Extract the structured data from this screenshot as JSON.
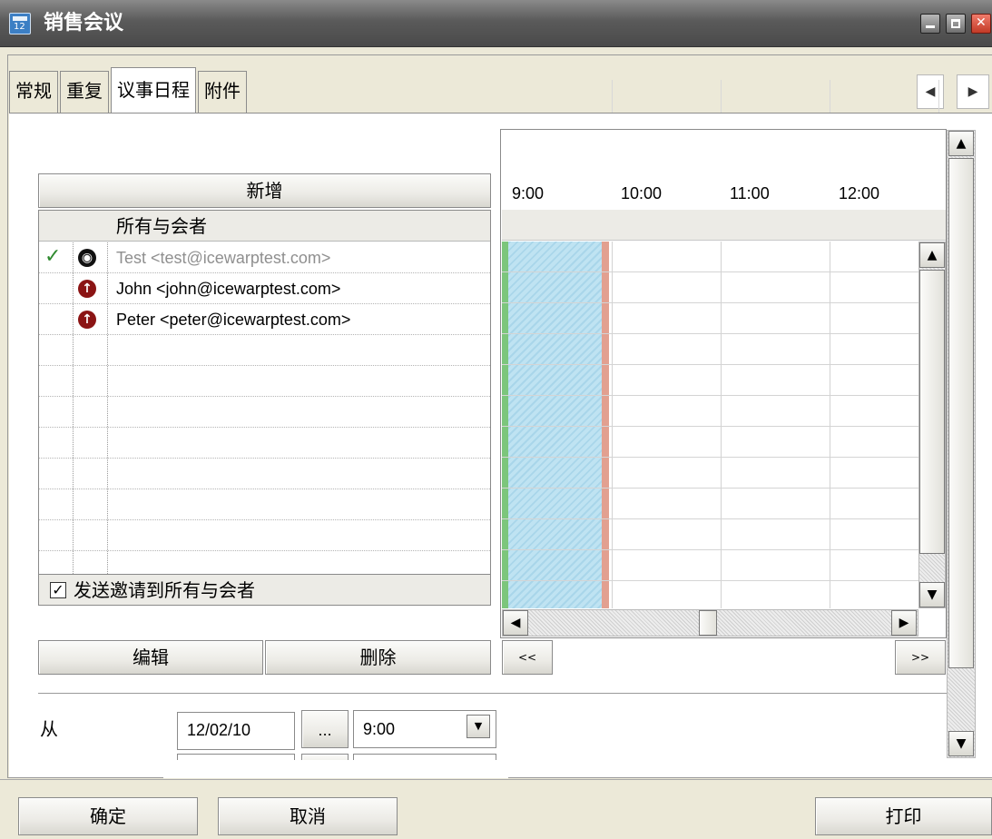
{
  "window": {
    "title": "销售会议",
    "icon_label": "12"
  },
  "tabs": [
    {
      "label": "常规"
    },
    {
      "label": "重复"
    },
    {
      "label": "议事日程",
      "active": true
    },
    {
      "label": "附件"
    }
  ],
  "tab_scroll": {
    "left": "◀",
    "right": "▶"
  },
  "attendees": {
    "add_label": "新增",
    "header": "所有与会者",
    "rows": [
      {
        "email": "Test <test@icewarptest.com>",
        "checked": true,
        "status": "accepted-icon"
      },
      {
        "email": "John <john@icewarptest.com>",
        "checked": false,
        "status": "pending-icon"
      },
      {
        "email": "Peter <peter@icewarptest.com>",
        "checked": false,
        "status": "pending-icon"
      }
    ],
    "send_invite_label": "发送邀请到所有与会者",
    "send_invite_checked": true,
    "edit_label": "编辑",
    "delete_label": "删除"
  },
  "schedule": {
    "hours": [
      "9:00",
      "10:00",
      "11:00",
      "12:00"
    ],
    "prev_label": "<<",
    "next_label": ">>"
  },
  "from": {
    "label": "从",
    "date": "12/02/10",
    "picker_label": "...",
    "time": "9:00"
  },
  "footer": {
    "ok_label": "确定",
    "cancel_label": "取消",
    "print_label": "打印"
  },
  "colors": {
    "busy": "#bfe3f2",
    "start_marker": "#7cc67c",
    "end_marker": "#e2a090"
  }
}
